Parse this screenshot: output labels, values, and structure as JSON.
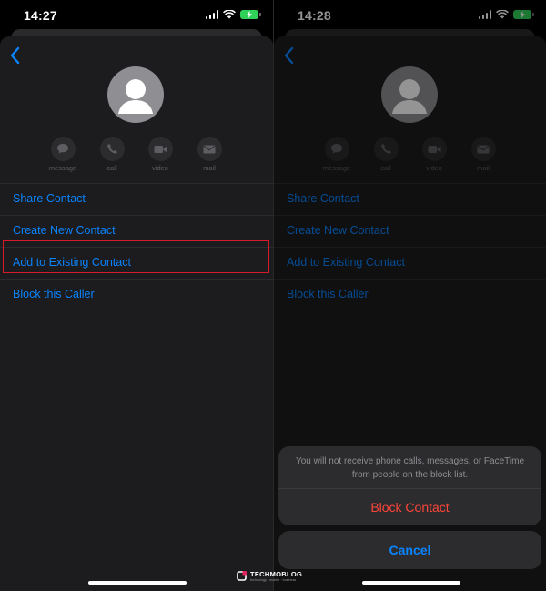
{
  "left_screen": {
    "status": {
      "time": "14:27"
    },
    "actions": [
      {
        "label": "message",
        "icon": "message-icon"
      },
      {
        "label": "call",
        "icon": "phone-icon"
      },
      {
        "label": "video",
        "icon": "video-icon"
      },
      {
        "label": "mail",
        "icon": "mail-icon"
      }
    ],
    "menu": [
      {
        "label": "Share Contact"
      },
      {
        "label": "Create New Contact"
      },
      {
        "label": "Add to Existing Contact"
      },
      {
        "label": "Block this Caller"
      }
    ],
    "highlighted_item": "Block this Caller"
  },
  "right_screen": {
    "status": {
      "time": "14:28"
    },
    "actions": [
      {
        "label": "message",
        "icon": "message-icon"
      },
      {
        "label": "call",
        "icon": "phone-icon"
      },
      {
        "label": "video",
        "icon": "video-icon"
      },
      {
        "label": "mail",
        "icon": "mail-icon"
      }
    ],
    "menu": [
      {
        "label": "Share Contact"
      },
      {
        "label": "Create New Contact"
      },
      {
        "label": "Add to Existing Contact"
      },
      {
        "label": "Block this Caller"
      }
    ],
    "alert": {
      "message": "You will not receive phone calls, messages, or FaceTime from people on the block list.",
      "block_label": "Block Contact",
      "cancel_label": "Cancel"
    }
  },
  "watermark": {
    "brand": "TECHMOBLOG",
    "tagline": "technology · mobile · business"
  },
  "colors": {
    "accent": "#0a84ff",
    "destructive": "#ff453a",
    "highlight_border": "#d7192a",
    "battery": "#30d158"
  }
}
